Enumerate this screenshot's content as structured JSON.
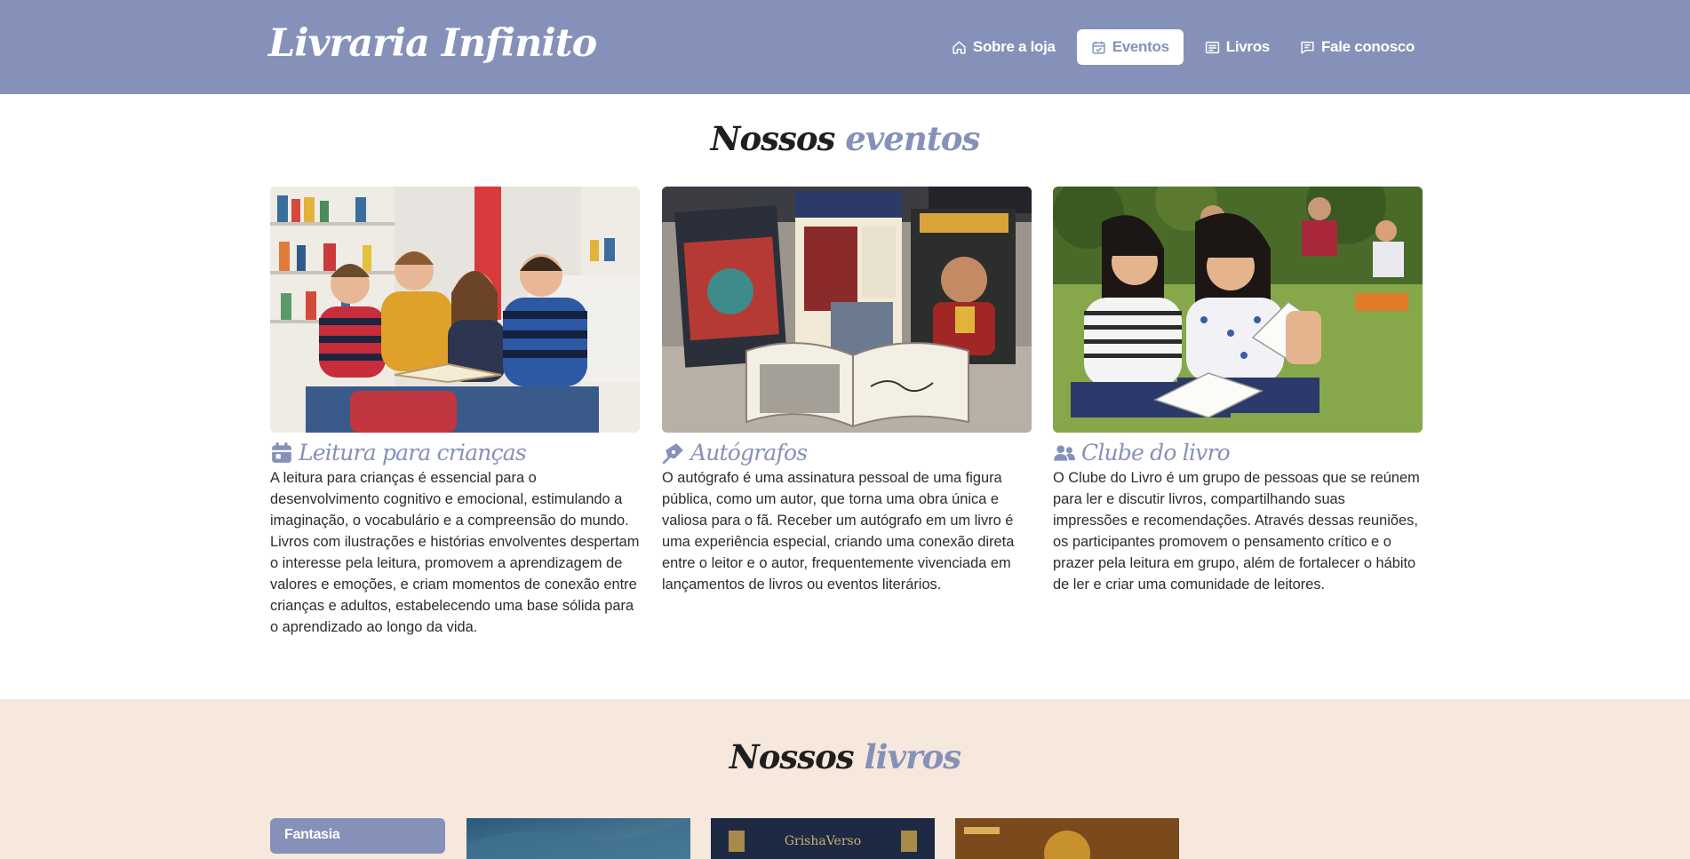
{
  "header": {
    "brand": "Livraria Infinito",
    "nav": [
      {
        "label": "Sobre a loja",
        "icon": "home-icon",
        "active": false
      },
      {
        "label": "Eventos",
        "icon": "calendar-check-icon",
        "active": true
      },
      {
        "label": "Livros",
        "icon": "book-list-icon",
        "active": false
      },
      {
        "label": "Fale conosco",
        "icon": "chat-icon",
        "active": false
      }
    ]
  },
  "events": {
    "title_part1": "Nossos",
    "title_part2": "eventos",
    "cards": [
      {
        "icon": "calendar-icon",
        "title": "Leitura para crianças",
        "text": "A leitura para crianças é essencial para o desenvolvimento cognitivo e emocional, estimulando a imaginação, o vocabulário e a compreensão do mundo. Livros com ilustrações e histórias envolventes despertam o interesse pela leitura, promovem a aprendizagem de valores e emoções, e criam momentos de conexão entre crianças e adultos, estabelecendo uma base sólida para o aprendizado ao longo da vida.",
        "image": "children-reading-photo"
      },
      {
        "icon": "signature-icon",
        "title": "Autógrafos",
        "text": "O autógrafo é uma assinatura pessoal de uma figura pública, como um autor, que torna uma obra única e valiosa para o fã. Receber um autógrafo em um livro é uma experiência especial, criando uma conexão direta entre o leitor e o autor, frequentemente vivenciada em lançamentos de livros ou eventos literários.",
        "image": "signed-books-photo"
      },
      {
        "icon": "users-icon",
        "title": "Clube do livro",
        "text": "O Clube do Livro é um grupo de pessoas que se reúnem para ler e discutir livros, compartilhando suas impressões e recomendações. Através dessas reuniões, os participantes promovem o pensamento crítico e o prazer pela leitura em grupo, além de fortalecer o hábito de ler e criar uma comunidade de leitores.",
        "image": "book-club-photo"
      }
    ]
  },
  "books": {
    "title_part1": "Nossos",
    "title_part2": "livros",
    "genre": "Fantasia",
    "cover_texts": [
      "GrishaVerso"
    ]
  },
  "colors": {
    "accent": "#8591b8",
    "books_bg": "#f7e8dd",
    "text": "#2c2c2c"
  }
}
